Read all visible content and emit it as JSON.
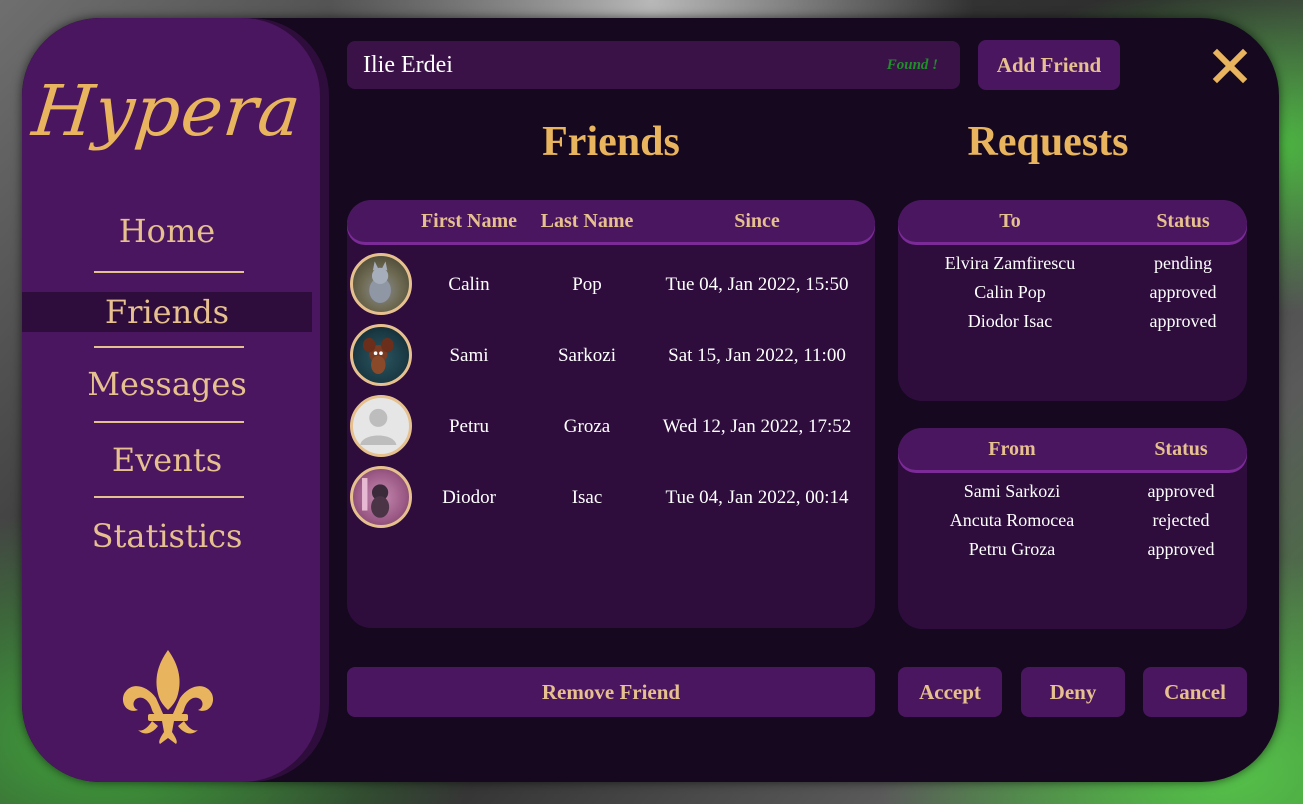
{
  "app": {
    "logo": "Hypera"
  },
  "nav": {
    "items": [
      {
        "label": "Home"
      },
      {
        "label": "Friends"
      },
      {
        "label": "Messages"
      },
      {
        "label": "Events"
      },
      {
        "label": "Statistics"
      }
    ]
  },
  "search": {
    "value": "Ilie Erdei",
    "status": "Found !"
  },
  "toolbar": {
    "add_friend": "Add Friend"
  },
  "friends": {
    "title": "Friends",
    "columns": [
      "First Name",
      "Last Name",
      "Since"
    ],
    "rows": [
      {
        "first": "Calin",
        "last": "Pop",
        "since": "Tue 04, Jan 2022, 15:50"
      },
      {
        "first": "Sami",
        "last": "Sarkozi",
        "since": "Sat 15, Jan 2022, 11:00"
      },
      {
        "first": "Petru",
        "last": "Groza",
        "since": "Wed 12, Jan 2022, 17:52"
      },
      {
        "first": "Diodor",
        "last": "Isac",
        "since": "Tue 04, Jan 2022, 00:14"
      }
    ],
    "remove_label": "Remove Friend"
  },
  "requests": {
    "title": "Requests",
    "sent": {
      "columns": [
        "To",
        "Status"
      ],
      "rows": [
        {
          "name": "Elvira Zamfirescu",
          "status": "pending"
        },
        {
          "name": "Calin Pop",
          "status": "approved"
        },
        {
          "name": "Diodor Isac",
          "status": "approved"
        }
      ]
    },
    "received": {
      "columns": [
        "From",
        "Status"
      ],
      "rows": [
        {
          "name": "Sami Sarkozi",
          "status": "approved"
        },
        {
          "name": "Ancuta Romocea",
          "status": "rejected"
        },
        {
          "name": "Petru Groza",
          "status": "approved"
        }
      ]
    },
    "accept_label": "Accept",
    "deny_label": "Deny",
    "cancel_label": "Cancel"
  },
  "colors": {
    "accent": "#e9b45e",
    "panel": "#2e0d3d",
    "sidebar": "#4a165f",
    "window": "#15081f"
  }
}
